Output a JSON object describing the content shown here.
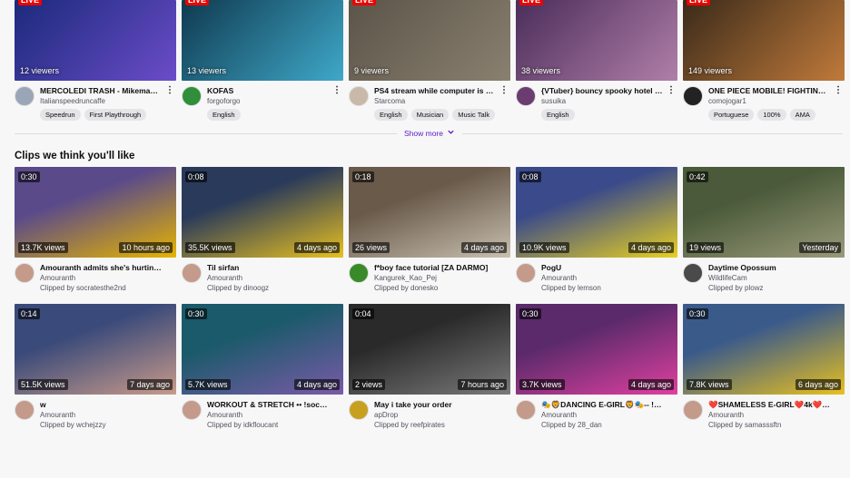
{
  "live_badge": "LIVE",
  "show_more": "Show more",
  "clips_heading": "Clips we think you'll like",
  "streams": [
    {
      "viewers": "12 viewers",
      "title": "MERCOLEDI TRASH - Mikemax e ...",
      "channel": "Italianspeedruncaffe",
      "tags": [
        "Speedrun",
        "First Playthrough"
      ],
      "colors": [
        "#1b2a7a",
        "#6b4cc9"
      ],
      "avatar": "#9aa6b8"
    },
    {
      "viewers": "13 viewers",
      "title": "KOFAS",
      "channel": "forgoforgo",
      "tags": [
        "English"
      ],
      "colors": [
        "#0f3a4f",
        "#3fa8c9"
      ],
      "avatar": "#2f8f3b"
    },
    {
      "viewers": "9 viewers",
      "title": "PS4 stream while computer is bei...",
      "channel": "Starcoma",
      "tags": [
        "English",
        "Musician",
        "Music Talk"
      ],
      "colors": [
        "#5b5448",
        "#8a8070"
      ],
      "avatar": "#c9b9a8"
    },
    {
      "viewers": "38 viewers",
      "title": "{VTuber} bouncy spooky hotel ad...",
      "channel": "susuika",
      "tags": [
        "English"
      ],
      "colors": [
        "#4a2d5a",
        "#b07fa8"
      ],
      "avatar": "#6a3c6f"
    },
    {
      "viewers": "149 viewers",
      "title": "ONE PIECE MOBILE! FIGHTING PA...",
      "channel": "comojogar1",
      "tags": [
        "Portuguese",
        "100%",
        "AMA"
      ],
      "colors": [
        "#3a2a1a",
        "#c07a3a"
      ],
      "avatar": "#222222"
    }
  ],
  "clips_row1": [
    {
      "duration": "0:30",
      "views": "13.7K views",
      "age": "10 hours ago",
      "title": "Amouranth admits she's hurting ad re...",
      "channel": "Amouranth",
      "clipped": "Clipped by socratesthe2nd",
      "colors": [
        "#5a4a8a",
        "#e6b400"
      ],
      "avatar": "#c49a8a"
    },
    {
      "duration": "0:08",
      "views": "35.5K views",
      "age": "4 days ago",
      "title": "Til sirfan",
      "channel": "Amouranth",
      "clipped": "Clipped by dinoogz",
      "colors": [
        "#2a3a5a",
        "#e8c020"
      ],
      "avatar": "#c49a8a"
    },
    {
      "duration": "0:18",
      "views": "26 views",
      "age": "4 days ago",
      "title": "f*boy face tutorial [ZA DARMO]",
      "channel": "Kangurek_Kao_Pej",
      "clipped": "Clipped by donesko",
      "colors": [
        "#6a5a4a",
        "#c8c0b0"
      ],
      "avatar": "#3a8a2a"
    },
    {
      "duration": "0:08",
      "views": "10.9K views",
      "age": "4 days ago",
      "title": "PogU",
      "channel": "Amouranth",
      "clipped": "Clipped by lemson",
      "colors": [
        "#3a4a8a",
        "#e8d020"
      ],
      "avatar": "#c49a8a"
    },
    {
      "duration": "0:42",
      "views": "19 views",
      "age": "Yesterday",
      "title": "Daytime Opossum",
      "channel": "WildlifeCam",
      "clipped": "Clipped by plowz",
      "colors": [
        "#4a5a3a",
        "#9a9a7a"
      ],
      "avatar": "#4a4a4a"
    }
  ],
  "clips_row2": [
    {
      "duration": "0:14",
      "views": "51.5K views",
      "age": "7 days ago",
      "title": "w",
      "channel": "Amouranth",
      "clipped": "Clipped by wchejzzy",
      "colors": [
        "#3a4a7a",
        "#c89a8a"
      ],
      "avatar": "#c49a8a"
    },
    {
      "duration": "0:30",
      "views": "5.7K views",
      "age": "4 days ago",
      "title": "WORKOUT & STRETCH •• !social •• !i...",
      "channel": "Amouranth",
      "clipped": "Clipped by idkfloucant",
      "colors": [
        "#1a5a6a",
        "#7a5aa8"
      ],
      "avatar": "#c49a8a"
    },
    {
      "duration": "0:04",
      "views": "2 views",
      "age": "7 hours ago",
      "title": "May i take your order",
      "channel": "apDrop",
      "clipped": "Clipped by reefpirates",
      "colors": [
        "#2a2a2a",
        "#7a7a7a"
      ],
      "avatar": "#c8a020"
    },
    {
      "duration": "0:30",
      "views": "3.7K views",
      "age": "4 days ago",
      "title": "🎭🦁DANCING E-GIRL🦁🎭-- !insta...",
      "channel": "Amouranth",
      "clipped": "Clipped by 28_dan",
      "colors": [
        "#5a2a6a",
        "#e040a0"
      ],
      "avatar": "#c49a8a"
    },
    {
      "duration": "0:30",
      "views": "7.8K views",
      "age": "6 days ago",
      "title": "❤️SHAMELESS E-GIRL❤️4k❤️IG: am...",
      "channel": "Amouranth",
      "clipped": "Clipped by samasssftn",
      "colors": [
        "#3a5a8a",
        "#e8c020"
      ],
      "avatar": "#c49a8a"
    }
  ]
}
